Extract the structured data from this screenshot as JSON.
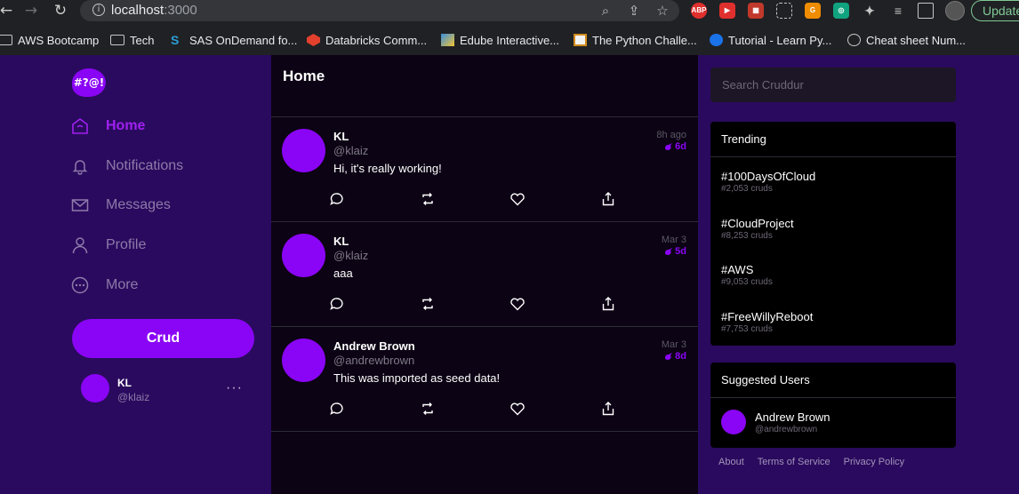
{
  "browser": {
    "url_host": "localhost",
    "url_port": ":3000",
    "update_label": "Update",
    "bookmarks": [
      {
        "label": "AWS Bootcamp",
        "icon": "folder-icon"
      },
      {
        "label": "Tech",
        "icon": "folder-icon"
      },
      {
        "label": "SAS OnDemand fo...",
        "icon": "sas-icon"
      },
      {
        "label": "Databricks Comm...",
        "icon": "databricks-icon"
      },
      {
        "label": "Edube Interactive...",
        "icon": "edube-icon"
      },
      {
        "label": "The Python Challe...",
        "icon": "python-challenge-icon"
      },
      {
        "label": "Tutorial - Learn Py...",
        "icon": "tutorial-icon"
      },
      {
        "label": "Cheat sheet Num...",
        "icon": "globe-icon"
      }
    ],
    "extensions": [
      "ABP"
    ]
  },
  "app": {
    "logo_text": "#?@!",
    "nav": [
      {
        "label": "Home",
        "icon": "home-icon",
        "active": true
      },
      {
        "label": "Notifications",
        "icon": "bell-icon",
        "active": false
      },
      {
        "label": "Messages",
        "icon": "mail-icon",
        "active": false
      },
      {
        "label": "Profile",
        "icon": "person-icon",
        "active": false
      },
      {
        "label": "More",
        "icon": "more-circle-icon",
        "active": false
      }
    ],
    "crud_button": "Crud",
    "me": {
      "name": "KL",
      "handle": "@klaiz",
      "more": "···"
    },
    "colors": {
      "accent": "#8a05f5",
      "sidebar_bg": "#2a0a5e",
      "feed_bg": "#0c0314"
    }
  },
  "feed": {
    "title": "Home",
    "posts": [
      {
        "name": "KL",
        "handle": "@klaiz",
        "text": "Hi, it's really working!",
        "time": "8h ago",
        "expires": "6d"
      },
      {
        "name": "KL",
        "handle": "@klaiz",
        "text": "aaa",
        "time": "Mar 3",
        "expires": "5d"
      },
      {
        "name": "Andrew Brown",
        "handle": "@andrewbrown",
        "text": "This was imported as seed data!",
        "time": "Mar 3",
        "expires": "8d"
      }
    ]
  },
  "sidebar_right": {
    "search_placeholder": "Search Cruddur",
    "trending_title": "Trending",
    "trending": [
      {
        "name": "#100DaysOfCloud",
        "count": "#2,053 cruds"
      },
      {
        "name": "#CloudProject",
        "count": "#8,253 cruds"
      },
      {
        "name": "#AWS",
        "count": "#9,053 cruds"
      },
      {
        "name": "#FreeWillyReboot",
        "count": "#7,753 cruds"
      }
    ],
    "suggested_title": "Suggested Users",
    "suggested": [
      {
        "name": "Andrew Brown",
        "handle": "@andrewbrown"
      }
    ],
    "footer": [
      "About",
      "Terms of Service",
      "Privacy Policy"
    ]
  }
}
